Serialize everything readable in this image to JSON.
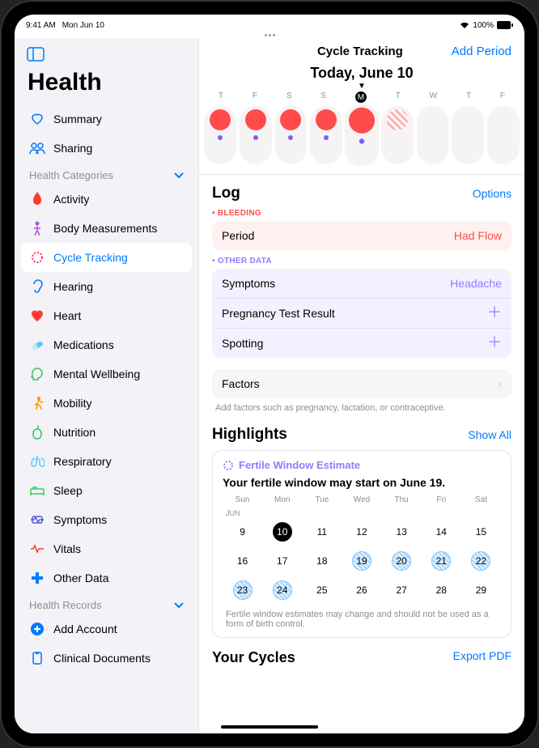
{
  "status": {
    "time": "9:41 AM",
    "date": "Mon Jun 10",
    "battery": "100%"
  },
  "sidebar": {
    "title": "Health",
    "nav": [
      {
        "label": "Summary",
        "color": "#007aff"
      },
      {
        "label": "Sharing",
        "color": "#007aff"
      }
    ],
    "categories_header": "Health Categories",
    "categories": [
      {
        "label": "Activity",
        "color": "#ff3b30"
      },
      {
        "label": "Body Measurements",
        "color": "#af52de"
      },
      {
        "label": "Cycle Tracking",
        "color": "#ff2d55",
        "active": true
      },
      {
        "label": "Hearing",
        "color": "#007aff"
      },
      {
        "label": "Heart",
        "color": "#ff3b30"
      },
      {
        "label": "Medications",
        "color": "#5ac8fa"
      },
      {
        "label": "Mental Wellbeing",
        "color": "#34c759"
      },
      {
        "label": "Mobility",
        "color": "#ff9500"
      },
      {
        "label": "Nutrition",
        "color": "#34c759"
      },
      {
        "label": "Respiratory",
        "color": "#5ac8fa"
      },
      {
        "label": "Sleep",
        "color": "#30d158"
      },
      {
        "label": "Symptoms",
        "color": "#5856d6"
      },
      {
        "label": "Vitals",
        "color": "#ff3b30"
      },
      {
        "label": "Other Data",
        "color": "#007aff"
      }
    ],
    "records_header": "Health Records",
    "records": [
      {
        "label": "Add Account",
        "color": "#007aff"
      },
      {
        "label": "Clinical Documents",
        "color": "#007aff"
      }
    ]
  },
  "main": {
    "title": "Cycle Tracking",
    "add_period": "Add Period",
    "today_label": "Today, June 10",
    "week_letters": [
      "T",
      "F",
      "S",
      "S",
      "M",
      "T",
      "W",
      "T",
      "F"
    ],
    "week_current_index": 4,
    "pills": [
      {
        "period": true,
        "dot": true
      },
      {
        "period": true,
        "dot": true
      },
      {
        "period": true,
        "dot": true
      },
      {
        "period": true,
        "dot": true
      },
      {
        "period": true,
        "dot": true,
        "today": true
      },
      {
        "hatch": true
      },
      {},
      {},
      {}
    ],
    "log": {
      "header": "Log",
      "options": "Options",
      "bleeding_label": "BLEEDING",
      "period_label": "Period",
      "period_value": "Had Flow",
      "other_label": "OTHER DATA",
      "symptoms_label": "Symptoms",
      "symptoms_value": "Headache",
      "pregnancy_label": "Pregnancy Test Result",
      "spotting_label": "Spotting",
      "factors_label": "Factors",
      "factors_hint": "Add factors such as pregnancy, lactation, or contraceptive."
    },
    "highlights": {
      "header": "Highlights",
      "show_all": "Show All",
      "hl_title": "Fertile Window Estimate",
      "hl_sub": "Your fertile window may start on June 19.",
      "days_of_week": [
        "Sun",
        "Mon",
        "Tue",
        "Wed",
        "Thu",
        "Fri",
        "Sat"
      ],
      "month_label": "JUN",
      "weeks": [
        [
          9,
          10,
          11,
          12,
          13,
          14,
          15
        ],
        [
          16,
          17,
          18,
          19,
          20,
          21,
          22
        ],
        [
          23,
          24,
          25,
          26,
          27,
          28,
          29
        ]
      ],
      "today": 10,
      "fertile": [
        19,
        20,
        21,
        22,
        23,
        24
      ],
      "disclaimer": "Fertile window estimates may change and should not be used as a form of birth control."
    },
    "cycles_header": "Your Cycles",
    "export": "Export PDF"
  }
}
